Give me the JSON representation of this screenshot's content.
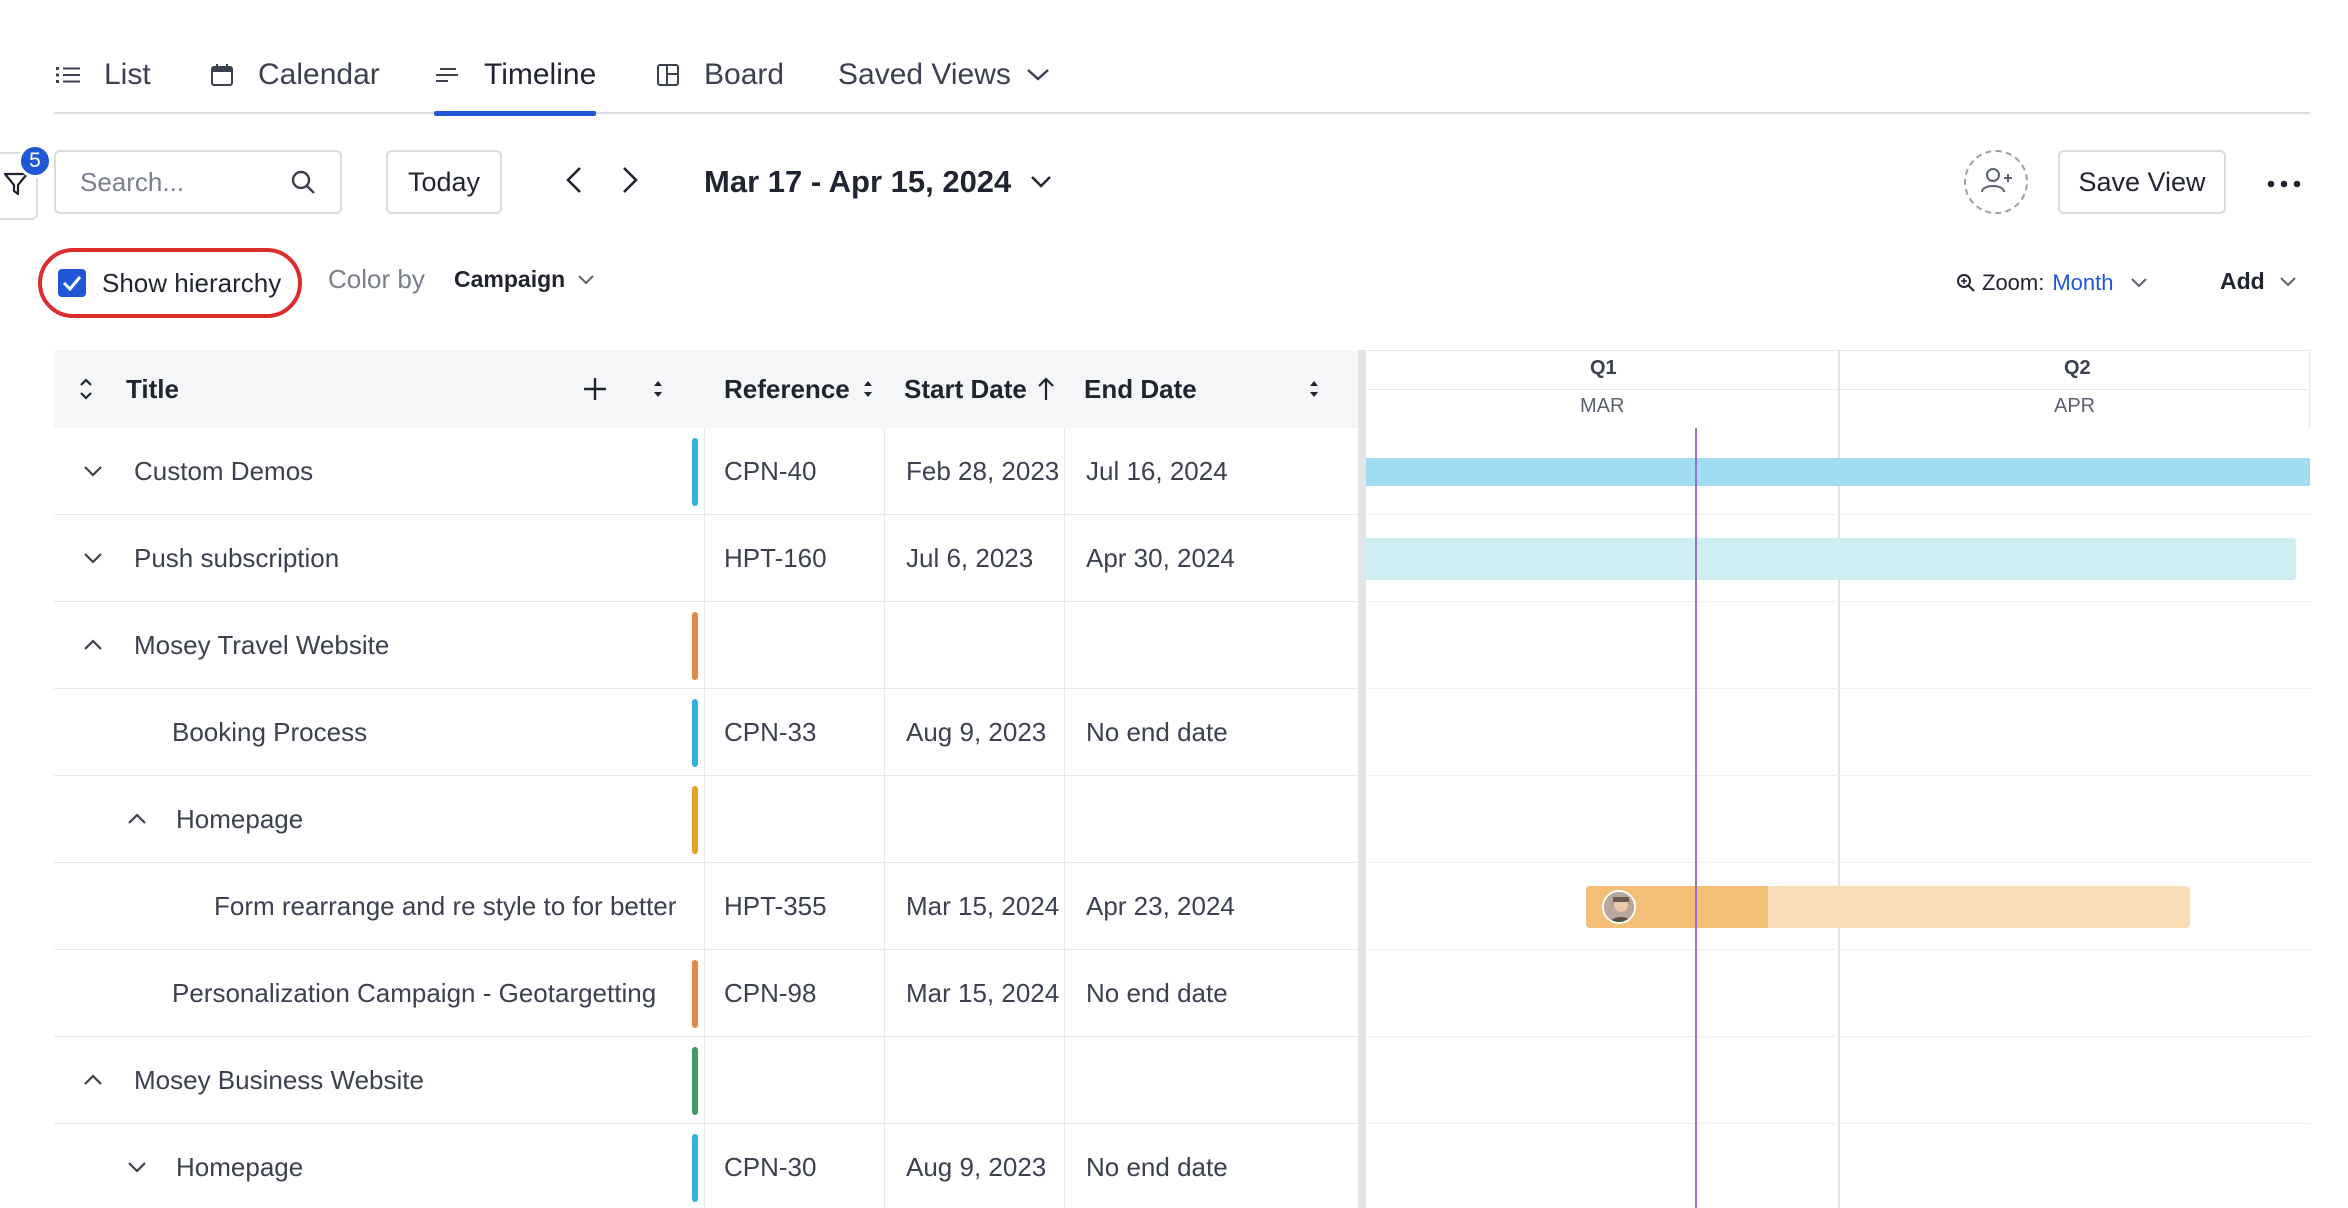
{
  "tabs": [
    {
      "label": "List",
      "icon": "list-icon"
    },
    {
      "label": "Calendar",
      "icon": "calendar-icon"
    },
    {
      "label": "Timeline",
      "icon": "timeline-icon",
      "active": true
    },
    {
      "label": "Board",
      "icon": "board-icon"
    },
    {
      "label": "Saved Views",
      "icon": "chevron-down-icon"
    }
  ],
  "toolbar": {
    "filter_count": "5",
    "search_placeholder": "Search...",
    "today_label": "Today",
    "date_range": "Mar 17 - Apr 15, 2024",
    "save_view_label": "Save View"
  },
  "options": {
    "show_hierarchy_label": "Show hierarchy",
    "show_hierarchy_checked": true,
    "color_by_label": "Color by",
    "color_by_value": "Campaign",
    "zoom_label": "Zoom:",
    "zoom_value": "Month",
    "add_label": "Add"
  },
  "columns": {
    "title": "Title",
    "reference": "Reference",
    "start_date": "Start Date",
    "end_date": "End Date"
  },
  "rows": [
    {
      "title": "Custom Demos",
      "reference": "CPN-40",
      "start": "Feb 28, 2023",
      "end": "Jul 16, 2024",
      "color": "#2fb0e0",
      "expander": "chevron-down"
    },
    {
      "title": "Push subscription",
      "reference": "HPT-160",
      "start": "Jul 6, 2023",
      "end": "Apr 30, 2024",
      "color": "",
      "expander": "chevron-down"
    },
    {
      "title": "Mosey Travel Website",
      "reference": "",
      "start": "",
      "end": "",
      "color": "#e4884a",
      "expander": "chevron-up"
    },
    {
      "title": "Booking Process",
      "reference": "CPN-33",
      "start": "Aug 9, 2023",
      "end": "No end date",
      "color": "#2fb0e0",
      "expander": ""
    },
    {
      "title": "Homepage",
      "reference": "",
      "start": "",
      "end": "",
      "color": "#e8a22b",
      "expander": "chevron-up"
    },
    {
      "title": "Form rearrange and re style to for better",
      "reference": "HPT-355",
      "start": "Mar 15, 2024",
      "end": "Apr 23, 2024",
      "color": "",
      "expander": ""
    },
    {
      "title": "Personalization Campaign - Geotargetting",
      "reference": "CPN-98",
      "start": "Mar 15, 2024",
      "end": "No end date",
      "color": "#e4884a",
      "expander": ""
    },
    {
      "title": "Mosey Business Website",
      "reference": "",
      "start": "",
      "end": "",
      "color": "#3f9a64",
      "expander": "chevron-up"
    },
    {
      "title": "Homepage",
      "reference": "CPN-30",
      "start": "Aug 9, 2023",
      "end": "No end date",
      "color": "#2fb0e0",
      "expander": "chevron-down"
    }
  ],
  "timeline": {
    "quarters": [
      "Q1",
      "Q2"
    ],
    "months": [
      "MAR",
      "APR"
    ],
    "bar_colors": {
      "custom_demos": "#a1dcf3",
      "push_subscription": "#cdeff1",
      "form_progress": "#f3be76",
      "form_remaining": "#f8dcb7"
    }
  }
}
